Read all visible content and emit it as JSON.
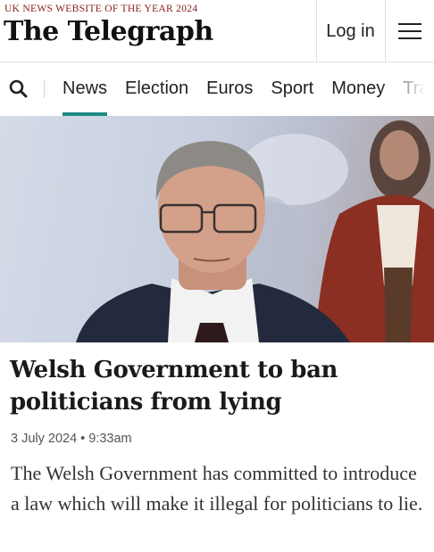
{
  "header": {
    "tagline": "UK NEWS WEBSITE OF THE YEAR 2024",
    "logo_text": "The Telegraph",
    "login_label": "Log in",
    "menu_icon": "hamburger-menu-icon"
  },
  "nav": {
    "search_icon": "search-icon",
    "items": [
      {
        "label": "News",
        "active": true
      },
      {
        "label": "Election",
        "active": false
      },
      {
        "label": "Euros",
        "active": false
      },
      {
        "label": "Sport",
        "active": false
      },
      {
        "label": "Money",
        "active": false
      },
      {
        "label": "Tra",
        "active": false
      }
    ],
    "accent_color": "#1c8a86"
  },
  "article": {
    "headline": "Welsh Government to ban politicians from lying",
    "date": "3 July 2024",
    "time": "9:33am",
    "summary": "The Welsh Government has committed to introduce a law which will make it illegal for politicians to lie."
  }
}
